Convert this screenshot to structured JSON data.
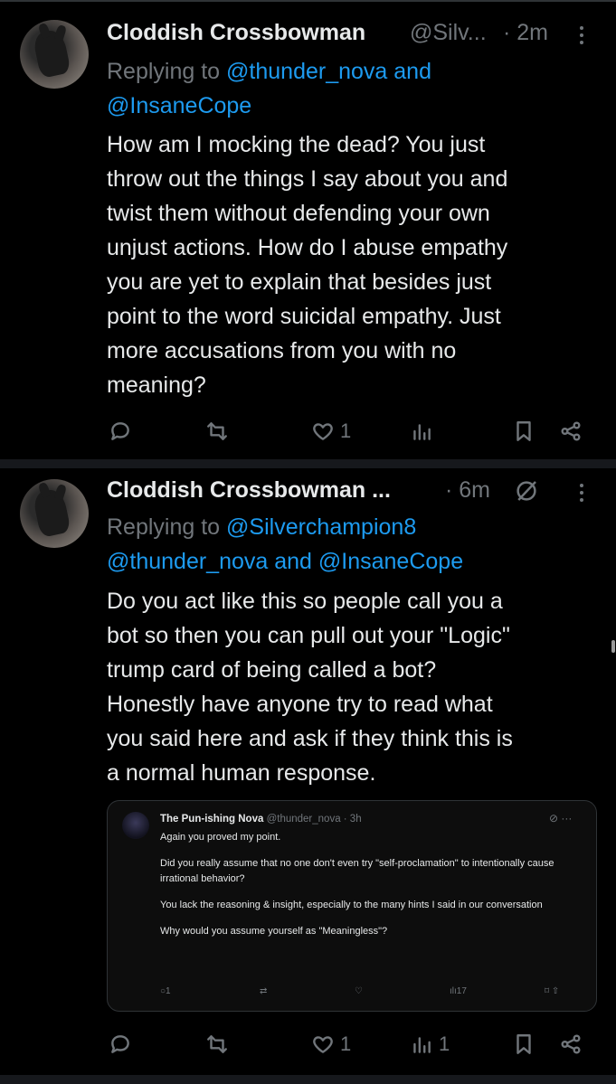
{
  "tweets": [
    {
      "author": "Cloddish Crossbowman",
      "handle": "@Silv...",
      "time": "· 2m",
      "replying_prefix": "Replying to ",
      "replying_line1": "@thunder_nova and",
      "replying_line2": "@InsaneCope",
      "body_lines": [
        "How am I mocking the dead? You just",
        "throw out the things I say about you and",
        "twist them without defending your own",
        "unjust actions. How do I abuse empathy",
        "you are yet to explain that besides just",
        "point to the word suicidal empathy. Just",
        "more accusations from you with no",
        "meaning?"
      ],
      "likes": "1",
      "views": "",
      "icons": [
        "reply-icon",
        "retweet-icon",
        "like-icon",
        "views-icon",
        "bookmark-icon",
        "share-icon"
      ]
    },
    {
      "author": "Cloddish Crossbowman ...",
      "handle": "",
      "time": "· 6m",
      "replying_prefix": "Replying to ",
      "replying_line1": "@Silverchampion8",
      "replying_line2": "@thunder_nova and @InsaneCope",
      "body_lines": [
        "Do you act like this so people call you a",
        "bot so then you can pull out your \"Logic\"",
        "trump card of being called a bot?",
        "Honestly have anyone try to read what",
        "you said here and ask if they think this is",
        "a normal human response."
      ],
      "likes": "1",
      "views": "1",
      "icons": [
        "reply-icon",
        "retweet-icon",
        "like-icon",
        "views-icon",
        "bookmark-icon",
        "share-icon",
        "grok-icon"
      ]
    }
  ],
  "quote": {
    "author": "The Pun-ishing Nova",
    "handle": "@thunder_nova · 3h",
    "paragraphs": [
      "Again you proved my point.",
      "Did you really assume that no one don't even try \"self-proclamation\" to intentionally cause irrational behavior?",
      "You lack the reasoning & insight, especially to the many hints I said in our conversation",
      "Why would you assume yourself as \"Meaningless\"?"
    ],
    "replies": "1",
    "views": "17"
  },
  "colors": {
    "background": "#000000",
    "text": "#e7e9ea",
    "muted": "#71767b",
    "link": "#1d9bf0",
    "divider": "#16181c"
  }
}
